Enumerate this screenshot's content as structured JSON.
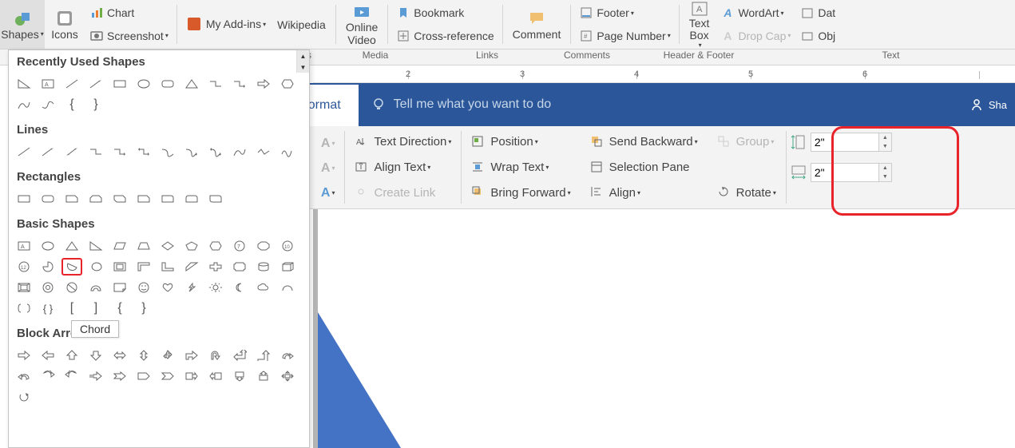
{
  "ribbon": {
    "shapes": "Shapes",
    "icons": "Icons",
    "chart": "Chart",
    "screenshot": "Screenshot",
    "my_addins": "My Add-ins",
    "wikipedia": "Wikipedia",
    "online_video": "Online\nVideo",
    "bookmark": "Bookmark",
    "cross_reference": "Cross-reference",
    "comment": "Comment",
    "footer": "Footer",
    "page_number": "Page Number",
    "text_box": "Text\nBox",
    "wordart": "WordArt",
    "drop_cap": "Drop Cap",
    "date_time": "Dat",
    "obj": "Obj"
  },
  "groups": {
    "addins": "ins",
    "media": "Media",
    "links": "Links",
    "comments": "Comments",
    "header_footer": "Header & Footer",
    "text": "Text"
  },
  "format_tab": "Format",
  "tell_me": "Tell me what you want to do",
  "share": "Sha",
  "format": {
    "text_direction": "Text Direction",
    "align_text": "Align Text",
    "create_link": "Create Link",
    "position": "Position",
    "wrap_text": "Wrap Text",
    "bring_forward": "Bring Forward",
    "send_backward": "Send Backward",
    "selection_pane": "Selection Pane",
    "align": "Align",
    "group": "Group",
    "rotate": "Rotate",
    "height": "2\"",
    "width": "2\""
  },
  "shape_sections": {
    "recent": "Recently Used Shapes",
    "lines": "Lines",
    "rectangles": "Rectangles",
    "basic": "Basic Shapes",
    "block_arrows": "Block Arrows"
  },
  "tooltip_chord": "Chord",
  "ruler": [
    "2",
    "3",
    "4",
    "5",
    "6"
  ]
}
